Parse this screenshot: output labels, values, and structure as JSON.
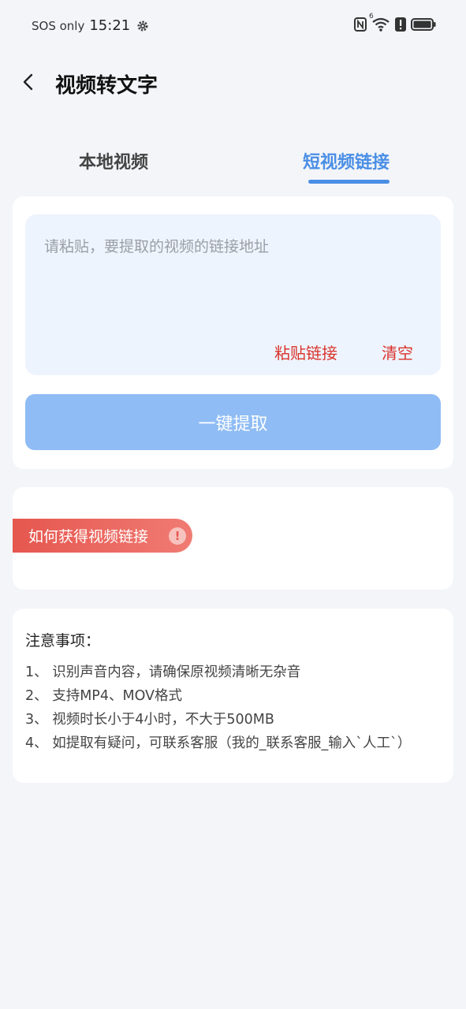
{
  "status_bar": {
    "carrier": "SOS only",
    "time": "15:21",
    "icons": [
      "gear-icon",
      "nfc-icon",
      "wifi-icon",
      "alert-icon",
      "battery-icon"
    ],
    "wifi_badge": "6"
  },
  "header": {
    "title": "视频转文字"
  },
  "tabs": [
    {
      "label": "本地视频",
      "active": false
    },
    {
      "label": "短视频链接",
      "active": true
    }
  ],
  "input": {
    "placeholder": "请粘贴，要提取的视频的链接地址",
    "value": "",
    "paste_label": "粘贴链接",
    "clear_label": "清空"
  },
  "extract_button": {
    "label": "一键提取"
  },
  "help": {
    "label": "如何获得视频链接",
    "icon_text": "!"
  },
  "notes": {
    "title": "注意事项：",
    "items": [
      "1、 识别声音内容，请确保原视频清晰无杂音",
      "2、 支持MP4、MOV格式",
      "3、 视频时长小于4小时，不大于500MB",
      "4、 如提取有疑问，可联系客服（我的_联系客服_输入`人工`）"
    ]
  },
  "colors": {
    "accent": "#4a8ee5",
    "button_disabled": "#8fbcf4",
    "danger": "#d9332b",
    "background": "#f3f5f9",
    "input_bg": "#eef4fd"
  }
}
